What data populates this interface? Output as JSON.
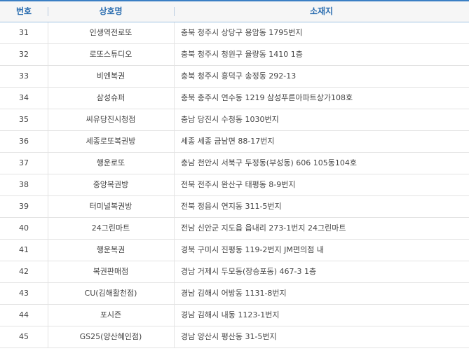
{
  "table": {
    "headers": {
      "number": "번호",
      "name": "상호명",
      "location": "소재지"
    },
    "rows": [
      {
        "number": "31",
        "name": "인생역전로또",
        "location": "충북 청주시 상당구 용암동 1795번지"
      },
      {
        "number": "32",
        "name": "로또스튜디오",
        "location": "충북 청주시 청원구 율량동 1410 1층"
      },
      {
        "number": "33",
        "name": "비엔복권",
        "location": "충북 청주시 흥덕구 송정동 292-13"
      },
      {
        "number": "34",
        "name": "삼성슈퍼",
        "location": "충북 충주시 연수동 1219 삼성푸른아파트상가108호"
      },
      {
        "number": "35",
        "name": "씨유당진시청점",
        "location": "충남 당진시 수청동 1030번지"
      },
      {
        "number": "36",
        "name": "세종로또복권방",
        "location": "세종 세종 금남면 88-17번지"
      },
      {
        "number": "37",
        "name": "행운로또",
        "location": "충남 천안시 서북구 두정동(부성동) 606 105동104호"
      },
      {
        "number": "38",
        "name": "중앙복권방",
        "location": "전북 전주시 완산구 태평동 8-9번지"
      },
      {
        "number": "39",
        "name": "터미널복권방",
        "location": "전북 정읍시 연지동 311-5번지"
      },
      {
        "number": "40",
        "name": "24그린마트",
        "location": "전남 신안군 지도읍 읍내리 273-1번지 24그린마트"
      },
      {
        "number": "41",
        "name": "행운복권",
        "location": "경북 구미시 진평동 119-2번지 JM편의점 내"
      },
      {
        "number": "42",
        "name": "복권판매점",
        "location": "경남 거제시 두모동(장승포동) 467-3 1층"
      },
      {
        "number": "43",
        "name": "CU(김해활천점)",
        "location": "경남 김해시 어방동 1131-8번지"
      },
      {
        "number": "44",
        "name": "포시즌",
        "location": "경남 김해시 내동 1123-1번지"
      },
      {
        "number": "45",
        "name": "GS25(양산혜인점)",
        "location": "경남 양산시 평산동 31-5번지"
      }
    ]
  }
}
